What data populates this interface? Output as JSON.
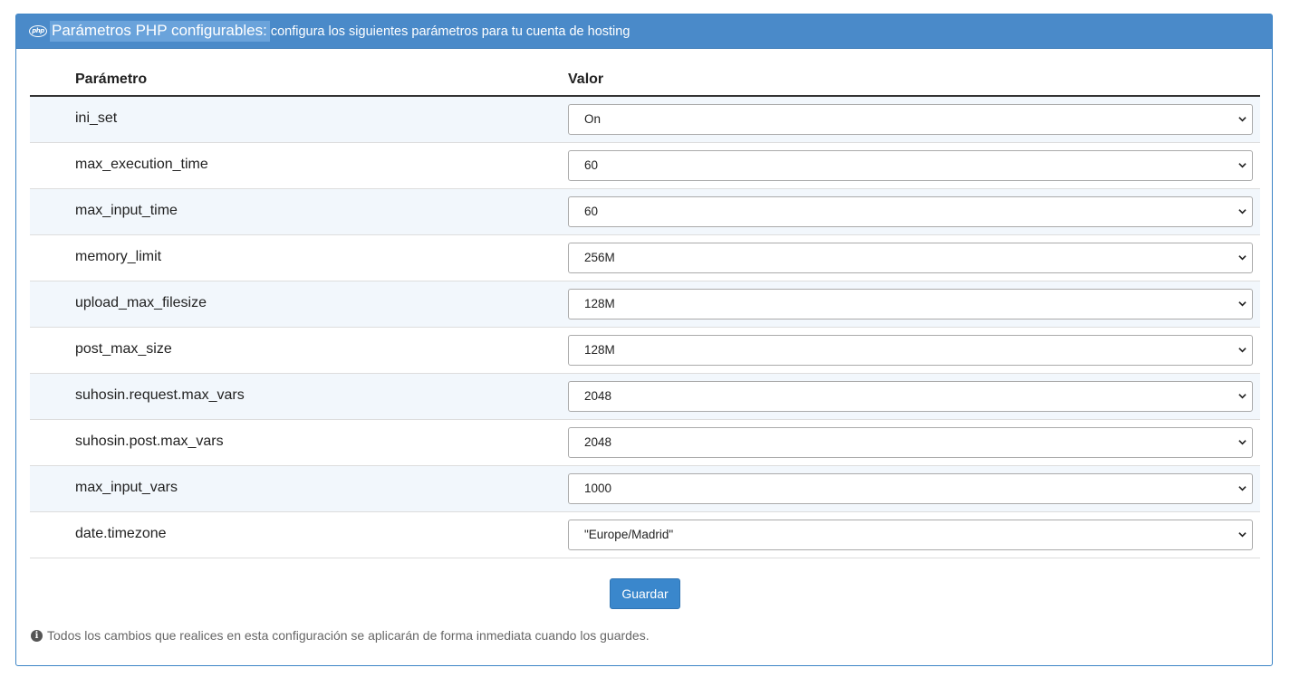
{
  "panel": {
    "icon": "php-icon",
    "title": "Parámetros PHP configurables:",
    "subtitle": "configura los siguientes parámetros para tu cuenta de hosting"
  },
  "table": {
    "headers": {
      "param": "Parámetro",
      "value": "Valor"
    },
    "rows": [
      {
        "param": "ini_set",
        "value": "On"
      },
      {
        "param": "max_execution_time",
        "value": "60"
      },
      {
        "param": "max_input_time",
        "value": "60"
      },
      {
        "param": "memory_limit",
        "value": "256M"
      },
      {
        "param": "upload_max_filesize",
        "value": "128M"
      },
      {
        "param": "post_max_size",
        "value": "128M"
      },
      {
        "param": "suhosin.request.max_vars",
        "value": "2048"
      },
      {
        "param": "suhosin.post.max_vars",
        "value": "2048"
      },
      {
        "param": "max_input_vars",
        "value": "1000"
      },
      {
        "param": "date.timezone",
        "value": "\"Europe/Madrid\""
      }
    ]
  },
  "actions": {
    "save_label": "Guardar"
  },
  "footer": {
    "icon": "info-circle-icon",
    "note": "Todos los cambios que realices en esta configuración se aplicarán de forma inmediata cuando los guardes."
  },
  "colors": {
    "header_bg": "#4a8ac9",
    "title_highlight": "#6aa3db",
    "button_bg": "#3a87cc",
    "stripe_bg": "#f2f7fc"
  }
}
